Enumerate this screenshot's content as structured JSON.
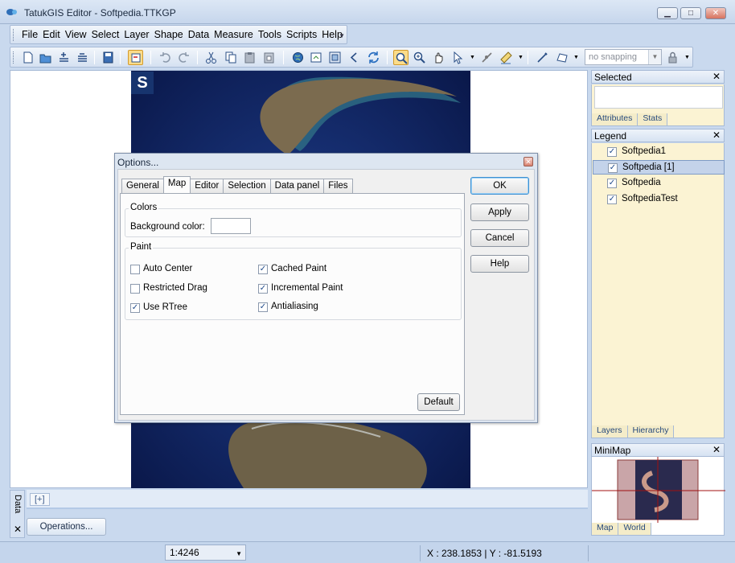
{
  "window": {
    "title": "TatukGIS Editor - Softpedia.TTKGP",
    "minimize": "▁",
    "maximize": "□",
    "close": "✕"
  },
  "menu": {
    "items": [
      "File",
      "Edit",
      "View",
      "Select",
      "Layer",
      "Shape",
      "Data",
      "Measure",
      "Tools",
      "Scripts",
      "Help"
    ]
  },
  "toolbar": {
    "snapping_value": "no snapping",
    "icons": [
      "new-icon",
      "open-icon",
      "add-layer-icon",
      "remove-layer-icon",
      "save-icon",
      "select-tool-icon",
      "undo-icon",
      "redo-icon",
      "cut-icon",
      "copy-icon",
      "paste-icon",
      "paste-special-icon",
      "globe-icon",
      "extent-icon",
      "full-extent-icon",
      "back-icon",
      "refresh-icon",
      "zoom-icon",
      "zoom-in-icon",
      "pan-icon",
      "select-arrow-icon",
      "edit-vertex-icon",
      "ruler-icon",
      "draw-line-icon",
      "draw-polygon-icon",
      "lock-icon"
    ]
  },
  "right_panels": {
    "selected": {
      "title": "Selected",
      "tabs": [
        "Attributes",
        "Stats"
      ]
    },
    "legend": {
      "title": "Legend",
      "items": [
        {
          "label": "Softpedia1",
          "checked": true,
          "selected": false
        },
        {
          "label": "Softpedia [1]",
          "checked": true,
          "selected": true
        },
        {
          "label": "Softpedia",
          "checked": true,
          "selected": false
        },
        {
          "label": "SoftpediaTest",
          "checked": true,
          "selected": false
        }
      ],
      "tabs": [
        "Layers",
        "Hierarchy"
      ]
    },
    "minimap": {
      "title": "MiniMap",
      "tabs": [
        "Map",
        "World"
      ]
    },
    "close_glyph": "✕"
  },
  "data_panel": {
    "tab_label": "Data",
    "plus_tab": "[+]",
    "close_glyph": "✕",
    "operations_button": "Operations..."
  },
  "status": {
    "scale": "1:4246",
    "coords": "X : 238.1853 | Y : -81.5193"
  },
  "map": {
    "logo_letter": "S"
  },
  "dialog": {
    "title": "Options...",
    "close_glyph": "✕",
    "tabs": [
      "General",
      "Map",
      "Editor",
      "Selection",
      "Data panel",
      "Files"
    ],
    "active_tab": "Map",
    "colors_group": {
      "title": "Colors",
      "background_label": "Background color:"
    },
    "paint_group": {
      "title": "Paint",
      "options": [
        {
          "label": "Auto Center",
          "checked": false
        },
        {
          "label": "Restricted Drag",
          "checked": false
        },
        {
          "label": "Use RTree",
          "checked": true
        },
        {
          "label": "Cached Paint",
          "checked": true
        },
        {
          "label": "Incremental Paint",
          "checked": true
        },
        {
          "label": "Antialiasing",
          "checked": true
        }
      ]
    },
    "buttons": {
      "ok": "OK",
      "apply": "Apply",
      "cancel": "Cancel",
      "help": "Help",
      "default": "Default"
    }
  },
  "colors": {
    "chrome": "#c9d9ee",
    "panel_fill": "#fbf3d3",
    "selection": "#c4d3ea",
    "accent": "#3f90d0"
  }
}
